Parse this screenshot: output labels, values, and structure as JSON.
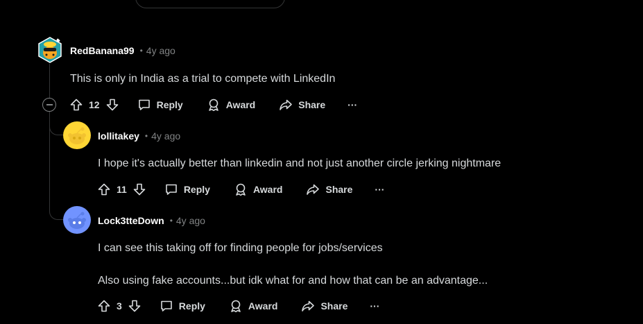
{
  "comments": [
    {
      "username": "RedBanana99",
      "time": "4y ago",
      "text": [
        "This is only in India as a trial to compete with LinkedIn"
      ],
      "votes": "12",
      "actions": {
        "reply": "Reply",
        "award": "Award",
        "share": "Share",
        "more": "···"
      }
    },
    {
      "username": "lollitakey",
      "time": "4y ago",
      "text": [
        "I hope it's actually better than linkedin and not just another circle jerking nightmare"
      ],
      "votes": "11",
      "actions": {
        "reply": "Reply",
        "award": "Award",
        "share": "Share",
        "more": "···"
      }
    },
    {
      "username": "Lock3tteDown",
      "time": "4y ago",
      "text": [
        "I can see this taking off for finding people for jobs/services",
        "Also using fake accounts...but idk what for and how that can be an advantage..."
      ],
      "votes": "3",
      "actions": {
        "reply": "Reply",
        "award": "Award",
        "share": "Share",
        "more": "···"
      }
    }
  ],
  "colors": {
    "background": "#000000",
    "text": "#D7DADC",
    "muted": "#818384",
    "username": "#FFFFFF",
    "thread_line": "#343536",
    "avatar_yellow": "#FFD635",
    "avatar_periwinkle": "#7193FF",
    "avatar_teal": "#24A0A8"
  },
  "icons": {
    "upvote": "arrow-up-outline-icon",
    "downvote": "arrow-down-outline-icon",
    "reply": "speech-bubble-icon",
    "award": "award-ribbon-icon",
    "share": "share-arrow-icon",
    "more": "ellipsis-icon",
    "collapse": "collapse-minus-icon"
  }
}
